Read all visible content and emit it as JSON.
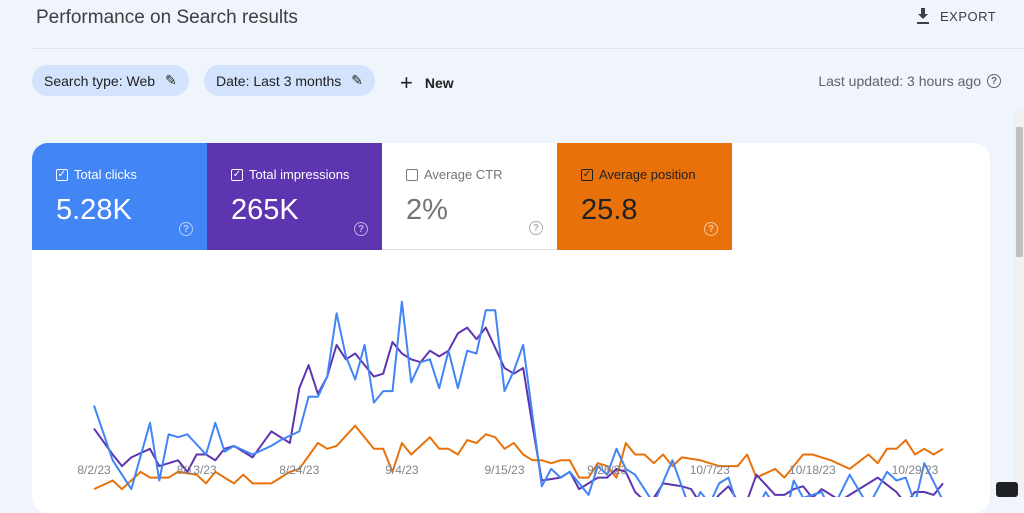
{
  "header": {
    "title": "Performance on Search results",
    "export_label": "EXPORT"
  },
  "filters": {
    "search_type": "Search type: Web",
    "date": "Date: Last 3 months",
    "new_label": "New",
    "last_updated": "Last updated: 3 hours ago"
  },
  "metrics": [
    {
      "label": "Total clicks",
      "value": "5.28K",
      "checked": true,
      "color": "#4285f4"
    },
    {
      "label": "Total impressions",
      "value": "265K",
      "checked": true,
      "color": "#5e35b1"
    },
    {
      "label": "Average CTR",
      "value": "2%",
      "checked": false,
      "color": "#ffffff"
    },
    {
      "label": "Average position",
      "value": "25.8",
      "checked": true,
      "color": "#e8710a"
    }
  ],
  "chart_data": {
    "type": "line",
    "title": "",
    "xlabel": "",
    "ylabel": "",
    "x_tick_labels": [
      "8/2/23",
      "8/13/23",
      "8/24/23",
      "9/4/23",
      "9/15/23",
      "9/26/23",
      "10/7/23",
      "10/18/23",
      "10/29/23"
    ],
    "x_range": [
      "8/2/23",
      "11/1/23"
    ],
    "y_note": "no y-axis labels shown; values are relative line heights",
    "grid": false,
    "series": [
      {
        "metric": "Total clicks",
        "color": "#4285f4",
        "points": [
          [
            "8/2/23",
            65
          ],
          [
            "8/4/23",
            46
          ],
          [
            "8/6/23",
            36
          ],
          [
            "8/8/23",
            59
          ],
          [
            "8/9/23",
            39
          ],
          [
            "8/10/23",
            55
          ],
          [
            "8/11/23",
            54
          ],
          [
            "8/12/23",
            55
          ],
          [
            "8/14/23",
            48
          ],
          [
            "8/15/23",
            59
          ],
          [
            "8/16/23",
            49
          ],
          [
            "8/17/23",
            51
          ],
          [
            "8/19/23",
            48
          ],
          [
            "8/21/23",
            51
          ],
          [
            "8/22/23",
            53
          ],
          [
            "8/24/23",
            56
          ],
          [
            "8/25/23",
            68
          ],
          [
            "8/26/23",
            68
          ],
          [
            "8/27/23",
            75
          ],
          [
            "8/28/23",
            97
          ],
          [
            "8/29/23",
            82
          ],
          [
            "8/30/23",
            74
          ],
          [
            "8/31/23",
            86
          ],
          [
            "9/1/23",
            66
          ],
          [
            "9/2/23",
            70
          ],
          [
            "9/3/23",
            70
          ],
          [
            "9/4/23",
            101
          ],
          [
            "9/5/23",
            73
          ],
          [
            "9/6/23",
            80
          ],
          [
            "9/7/23",
            81
          ],
          [
            "9/8/23",
            71
          ],
          [
            "9/9/23",
            84
          ],
          [
            "9/10/23",
            71
          ],
          [
            "9/11/23",
            84
          ],
          [
            "9/12/23",
            83
          ],
          [
            "9/13/23",
            98
          ],
          [
            "9/14/23",
            98
          ],
          [
            "9/15/23",
            70
          ],
          [
            "9/16/23",
            77
          ],
          [
            "9/17/23",
            86
          ],
          [
            "9/19/23",
            37
          ],
          [
            "9/20/23",
            43
          ],
          [
            "9/21/23",
            40
          ],
          [
            "9/22/23",
            42
          ],
          [
            "9/24/23",
            34
          ],
          [
            "9/25/23",
            44
          ],
          [
            "9/26/23",
            41
          ],
          [
            "9/27/23",
            50
          ],
          [
            "9/28/23",
            43
          ],
          [
            "9/29/23",
            41
          ],
          [
            "10/1/23",
            31
          ],
          [
            "10/3/23",
            46
          ],
          [
            "10/5/23",
            28
          ],
          [
            "10/6/23",
            35
          ],
          [
            "10/7/23",
            31
          ],
          [
            "10/8/23",
            38
          ],
          [
            "10/9/23",
            40
          ],
          [
            "10/10/23",
            30
          ],
          [
            "10/11/23",
            29
          ],
          [
            "10/12/23",
            29
          ],
          [
            "10/13/23",
            35
          ],
          [
            "10/15/23",
            25
          ],
          [
            "10/16/23",
            39
          ],
          [
            "10/17/23",
            33
          ],
          [
            "10/19/23",
            35
          ],
          [
            "10/20/23",
            28
          ],
          [
            "10/22/23",
            41
          ],
          [
            "10/24/23",
            30
          ],
          [
            "10/26/23",
            42
          ],
          [
            "10/27/23",
            39
          ],
          [
            "10/28/23",
            40
          ],
          [
            "10/29/23",
            31
          ],
          [
            "10/30/23",
            45
          ],
          [
            "11/1/23",
            32
          ]
        ]
      },
      {
        "metric": "Total impressions",
        "color": "#5e35b1",
        "points": [
          [
            "8/2/23",
            57
          ],
          [
            "8/4/23",
            48
          ],
          [
            "8/5/23",
            44
          ],
          [
            "8/6/23",
            47
          ],
          [
            "8/8/23",
            50
          ],
          [
            "8/9/23",
            44
          ],
          [
            "8/11/23",
            46
          ],
          [
            "8/12/23",
            42
          ],
          [
            "8/13/23",
            48
          ],
          [
            "8/14/23",
            48
          ],
          [
            "8/15/23",
            46
          ],
          [
            "8/16/23",
            50
          ],
          [
            "8/17/23",
            51
          ],
          [
            "8/19/23",
            47
          ],
          [
            "8/21/23",
            56
          ],
          [
            "8/22/23",
            54
          ],
          [
            "8/23/23",
            52
          ],
          [
            "8/24/23",
            71
          ],
          [
            "8/25/23",
            79
          ],
          [
            "8/26/23",
            69
          ],
          [
            "8/27/23",
            75
          ],
          [
            "8/28/23",
            86
          ],
          [
            "8/29/23",
            81
          ],
          [
            "8/30/23",
            83
          ],
          [
            "8/31/23",
            79
          ],
          [
            "9/1/23",
            75
          ],
          [
            "9/2/23",
            76
          ],
          [
            "9/3/23",
            87
          ],
          [
            "9/4/23",
            83
          ],
          [
            "9/5/23",
            81
          ],
          [
            "9/6/23",
            80
          ],
          [
            "9/7/23",
            84
          ],
          [
            "9/8/23",
            82
          ],
          [
            "9/9/23",
            84
          ],
          [
            "9/10/23",
            90
          ],
          [
            "9/11/23",
            92
          ],
          [
            "9/12/23",
            88
          ],
          [
            "9/13/23",
            92
          ],
          [
            "9/14/23",
            85
          ],
          [
            "9/15/23",
            78
          ],
          [
            "9/16/23",
            76
          ],
          [
            "9/17/23",
            78
          ],
          [
            "9/18/23",
            58
          ],
          [
            "9/19/23",
            39
          ],
          [
            "9/21/23",
            40
          ],
          [
            "9/22/23",
            42
          ],
          [
            "9/23/23",
            36
          ],
          [
            "9/25/23",
            40
          ],
          [
            "9/26/23",
            40
          ],
          [
            "9/27/23",
            43
          ],
          [
            "9/28/23",
            42
          ],
          [
            "9/29/23",
            35
          ],
          [
            "9/30/23",
            32
          ],
          [
            "10/1/23",
            33
          ],
          [
            "10/2/23",
            38
          ],
          [
            "10/4/23",
            37
          ],
          [
            "10/5/23",
            36
          ],
          [
            "10/6/23",
            31
          ],
          [
            "10/7/23",
            30
          ],
          [
            "10/8/23",
            34
          ],
          [
            "10/9/23",
            37
          ],
          [
            "10/10/23",
            32
          ],
          [
            "10/11/23",
            32
          ],
          [
            "10/12/23",
            41
          ],
          [
            "10/14/23",
            34
          ],
          [
            "10/15/23",
            34
          ],
          [
            "10/16/23",
            36
          ],
          [
            "10/17/23",
            37
          ],
          [
            "10/18/23",
            33
          ],
          [
            "10/19/23",
            36
          ],
          [
            "10/21/23",
            32
          ],
          [
            "10/22/23",
            34
          ],
          [
            "10/24/23",
            38
          ],
          [
            "10/25/23",
            40
          ],
          [
            "10/27/23",
            35
          ],
          [
            "10/28/23",
            31
          ],
          [
            "10/29/23",
            35
          ],
          [
            "10/30/23",
            35
          ],
          [
            "10/31/23",
            34
          ],
          [
            "11/1/23",
            38
          ]
        ]
      },
      {
        "metric": "Average position",
        "color": "#e8710a",
        "points": [
          [
            "8/2/23",
            36
          ],
          [
            "8/4/23",
            39
          ],
          [
            "8/5/23",
            36
          ],
          [
            "8/7/23",
            42
          ],
          [
            "8/8/23",
            40
          ],
          [
            "8/10/23",
            40
          ],
          [
            "8/11/23",
            42
          ],
          [
            "8/13/23",
            41
          ],
          [
            "8/14/23",
            38
          ],
          [
            "8/15/23",
            42
          ],
          [
            "8/17/23",
            38
          ],
          [
            "8/18/23",
            41
          ],
          [
            "8/19/23",
            38
          ],
          [
            "8/21/23",
            38
          ],
          [
            "8/22/23",
            40
          ],
          [
            "8/23/23",
            42
          ],
          [
            "8/24/23",
            43
          ],
          [
            "8/26/23",
            52
          ],
          [
            "8/27/23",
            50
          ],
          [
            "8/28/23",
            51
          ],
          [
            "8/30/23",
            58
          ],
          [
            "9/1/23",
            50
          ],
          [
            "9/2/23",
            50
          ],
          [
            "9/3/23",
            42
          ],
          [
            "9/4/23",
            52
          ],
          [
            "9/5/23",
            48
          ],
          [
            "9/7/23",
            54
          ],
          [
            "9/8/23",
            50
          ],
          [
            "9/9/23",
            50
          ],
          [
            "9/10/23",
            48
          ],
          [
            "9/11/23",
            53
          ],
          [
            "9/12/23",
            52
          ],
          [
            "9/13/23",
            55
          ],
          [
            "9/14/23",
            54
          ],
          [
            "9/15/23",
            50
          ],
          [
            "9/16/23",
            52
          ],
          [
            "9/17/23",
            48
          ],
          [
            "9/18/23",
            46
          ],
          [
            "9/19/23",
            46
          ],
          [
            "9/20/23",
            45
          ],
          [
            "9/21/23",
            46
          ],
          [
            "9/22/23",
            46
          ],
          [
            "9/23/23",
            40
          ],
          [
            "9/24/23",
            40
          ],
          [
            "9/25/23",
            45
          ],
          [
            "9/26/23",
            44
          ],
          [
            "9/27/23",
            40
          ],
          [
            "9/28/23",
            52
          ],
          [
            "9/29/23",
            48
          ],
          [
            "9/30/23",
            48
          ],
          [
            "10/1/23",
            45
          ],
          [
            "10/2/23",
            48
          ],
          [
            "10/3/23",
            44
          ],
          [
            "10/4/23",
            47
          ],
          [
            "10/6/23",
            46
          ],
          [
            "10/8/23",
            44
          ],
          [
            "10/10/23",
            44
          ],
          [
            "10/11/23",
            48
          ],
          [
            "10/12/23",
            40
          ],
          [
            "10/14/23",
            43
          ],
          [
            "10/15/23",
            40
          ],
          [
            "10/17/23",
            48
          ],
          [
            "10/18/23",
            48
          ],
          [
            "10/20/23",
            46
          ],
          [
            "10/22/23",
            43
          ],
          [
            "10/24/23",
            48
          ],
          [
            "10/25/23",
            45
          ],
          [
            "10/26/23",
            50
          ],
          [
            "10/27/23",
            50
          ],
          [
            "10/28/23",
            53
          ],
          [
            "10/29/23",
            48
          ],
          [
            "10/30/23",
            50
          ],
          [
            "10/31/23",
            48
          ],
          [
            "11/1/23",
            50
          ]
        ]
      }
    ]
  }
}
